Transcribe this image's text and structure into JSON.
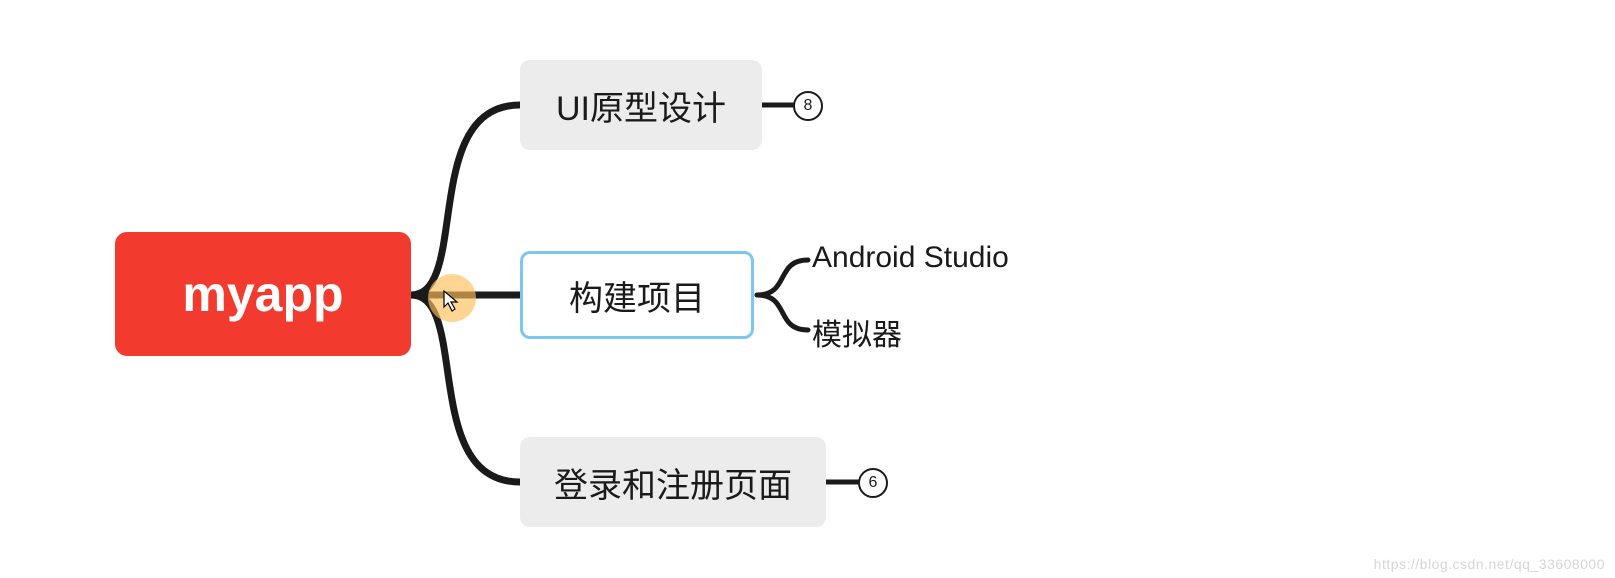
{
  "root": {
    "label": "myapp",
    "color": "#f33a2e"
  },
  "children": [
    {
      "id": "ui-design",
      "label": "UI原型设计",
      "collapsed_count": "8",
      "selected": false
    },
    {
      "id": "build-project",
      "label": "构建项目",
      "selected": true,
      "children": [
        {
          "label": "Android Studio"
        },
        {
          "label": "模拟器"
        }
      ]
    },
    {
      "id": "login-register",
      "label": "登录和注册页面",
      "collapsed_count": "6",
      "selected": false
    }
  ],
  "watermark": "https://blog.csdn.net/qq_33608000",
  "colors": {
    "root_bg": "#f33a2e",
    "node_bg": "#ececec",
    "selected_border": "#7cc7f2",
    "connector": "#1a1a1a"
  }
}
